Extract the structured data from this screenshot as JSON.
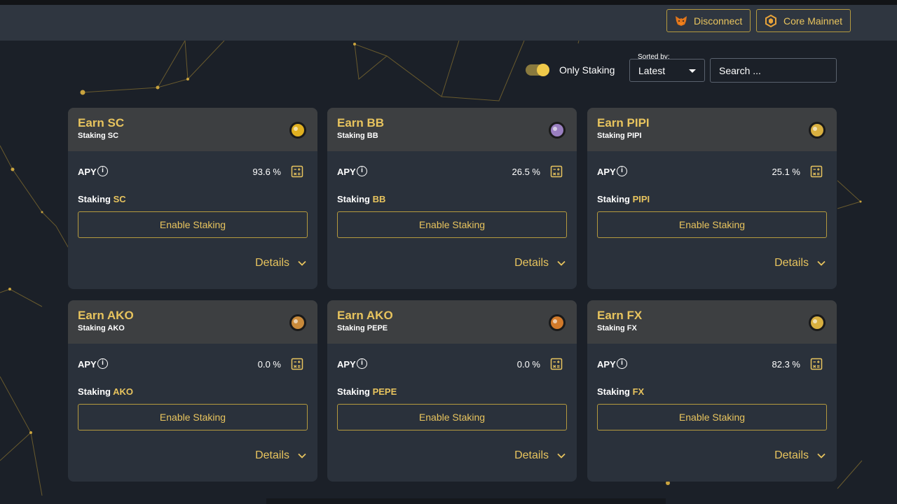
{
  "header": {
    "disconnect_label": "Disconnect",
    "network_label": "Core Mainnet"
  },
  "filters": {
    "toggle_label": "Only Staking",
    "toggle_on": true,
    "sort_caption": "Sorted by:",
    "sort_value": "Latest",
    "search_placeholder": "Search ..."
  },
  "colors": {
    "accent": "#e8c45e",
    "card_bg": "#2a313b",
    "card_head_bg": "#3d3f41",
    "page_bg": "#1b2028"
  },
  "pools": [
    {
      "title": "Earn SC",
      "subtitle": "Staking SC",
      "apy_label": "APY",
      "apy": "93.6 %",
      "staking_prefix": "Staking",
      "token": "SC",
      "button": "Enable Staking",
      "details": "Details",
      "icon": "sc-token-icon"
    },
    {
      "title": "Earn BB",
      "subtitle": "Staking BB",
      "apy_label": "APY",
      "apy": "26.5 %",
      "staking_prefix": "Staking",
      "token": "BB",
      "button": "Enable Staking",
      "details": "Details",
      "icon": "bb-token-icon"
    },
    {
      "title": "Earn PIPI",
      "subtitle": "Staking PIPI",
      "apy_label": "APY",
      "apy": "25.1 %",
      "staking_prefix": "Staking",
      "token": "PIPI",
      "button": "Enable Staking",
      "details": "Details",
      "icon": "pipi-token-icon"
    },
    {
      "title": "Earn AKO",
      "subtitle": "Staking AKO",
      "apy_label": "APY",
      "apy": "0.0 %",
      "staking_prefix": "Staking",
      "token": "AKO",
      "button": "Enable Staking",
      "details": "Details",
      "icon": "ako-token-icon"
    },
    {
      "title": "Earn AKO",
      "subtitle": "Staking PEPE",
      "apy_label": "APY",
      "apy": "0.0 %",
      "staking_prefix": "Staking",
      "token": "PEPE",
      "button": "Enable Staking",
      "details": "Details",
      "icon": "pepe-token-icon"
    },
    {
      "title": "Earn FX",
      "subtitle": "Staking FX",
      "apy_label": "APY",
      "apy": "82.3 %",
      "staking_prefix": "Staking",
      "token": "FX",
      "button": "Enable Staking",
      "details": "Details",
      "icon": "fx-token-icon"
    }
  ]
}
